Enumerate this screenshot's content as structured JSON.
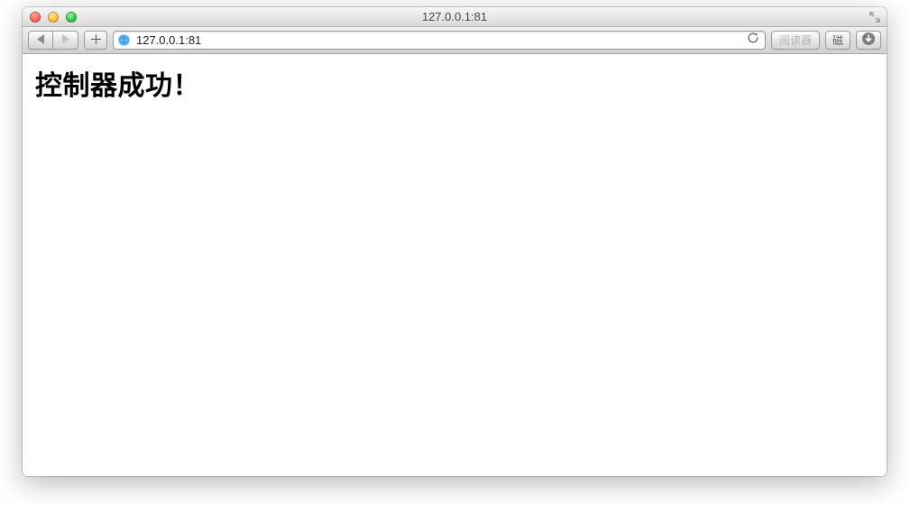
{
  "window": {
    "title": "127.0.0.1:81"
  },
  "icons": {
    "back": "back-triangle",
    "forward": "forward-triangle",
    "add": "plus",
    "globe": "safari-globe",
    "reload": "reload-arrow",
    "fullscreen": "fullscreen-diagonal",
    "download": "download-circle"
  },
  "toolbar": {
    "address": "127.0.0.1:81",
    "reader_label": "阅读器",
    "bookmark_label": "磁"
  },
  "page": {
    "heading": "控制器成功！"
  }
}
